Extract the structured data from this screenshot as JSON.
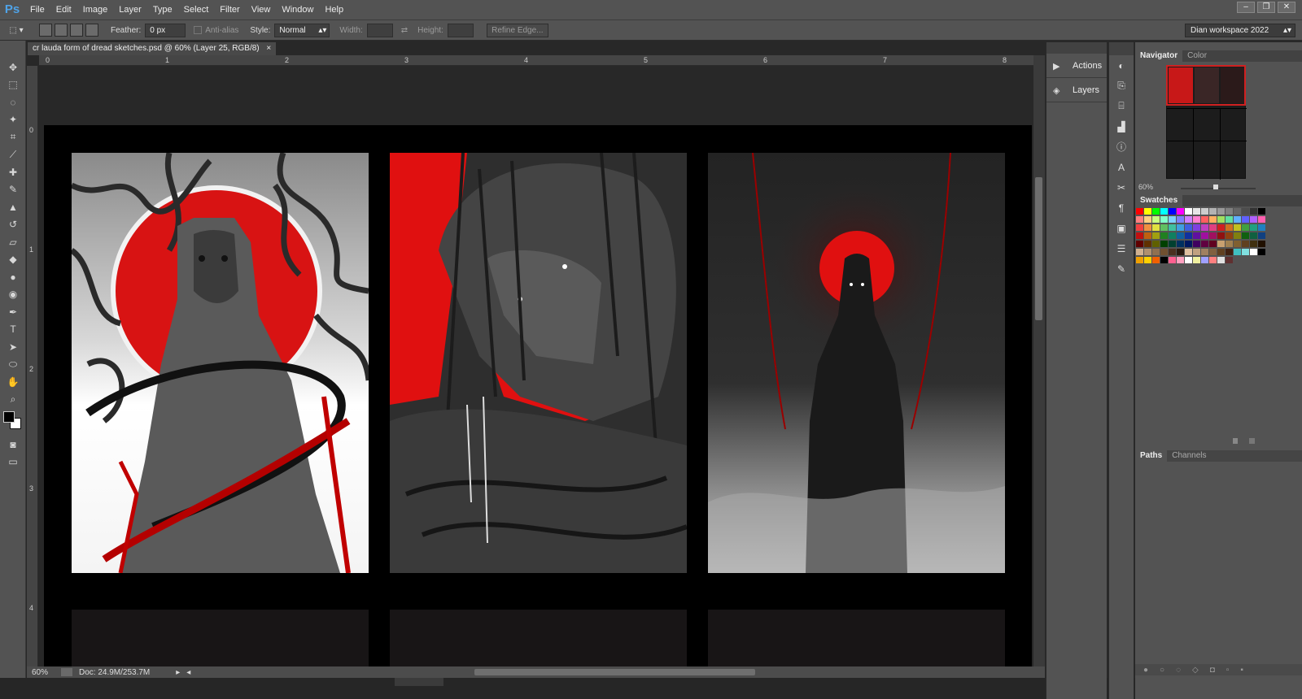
{
  "app": {
    "logo": "Ps"
  },
  "menu": [
    "File",
    "Edit",
    "Image",
    "Layer",
    "Type",
    "Select",
    "Filter",
    "View",
    "Window",
    "Help"
  ],
  "options": {
    "feather_label": "Feather:",
    "feather_value": "0 px",
    "antialias_label": "Anti-alias",
    "style_label": "Style:",
    "style_value": "Normal",
    "width_label": "Width:",
    "height_label": "Height:",
    "refine_label": "Refine Edge...",
    "workspace": "Dian workspace 2022"
  },
  "document": {
    "tab_title": "cr lauda form of dread sketches.psd @ 60% (Layer 25, RGB/8)",
    "ruler_h": [
      "0",
      "1",
      "2",
      "3",
      "4",
      "5",
      "6",
      "7",
      "8"
    ],
    "ruler_v": [
      "0",
      "1",
      "2",
      "3",
      "4"
    ],
    "zoom": "60%",
    "doc_size": "Doc: 24.9M/253.7M"
  },
  "dock": {
    "actions": "Actions",
    "layers": "Layers"
  },
  "panels": {
    "navigator_tab": "Navigator",
    "color_tab": "Color",
    "nav_zoom": "60%",
    "swatches_tab": "Swatches",
    "paths_tab": "Paths",
    "channels_tab": "Channels"
  },
  "colors": {
    "accent": "#e01010",
    "bg": "#282828",
    "panel": "#535353"
  }
}
